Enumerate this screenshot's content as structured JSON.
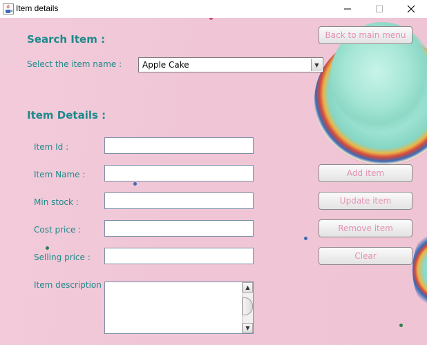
{
  "window": {
    "title": "Item details",
    "minimize_glyph": "—",
    "maximize_glyph": "☐",
    "close_glyph": "✕"
  },
  "search": {
    "heading": "Search Item :",
    "select_label": "Select the item name :",
    "selected_item": "Apple Cake"
  },
  "details": {
    "heading": "Item Details :",
    "item_id_label": "Item Id :",
    "item_name_label": "Item Name :",
    "min_stock_label": "Min stock :",
    "cost_price_label": "Cost price :",
    "selling_price_label": "Selling price :",
    "description_label": "Item description :",
    "item_id_value": "",
    "item_name_value": "",
    "min_stock_value": "",
    "cost_price_value": "",
    "selling_price_value": "",
    "description_value": ""
  },
  "buttons": {
    "back": "Back to main menu",
    "add": "Add item",
    "update": "Update item",
    "remove": "Remove item",
    "clear": "Clear"
  },
  "icons": {
    "app": "java-coffee-cup-icon",
    "combo_arrow": "▼",
    "scroll_up": "▲",
    "scroll_down": "▼"
  },
  "colors": {
    "label_teal": "#1e8a8a",
    "button_text_pink": "#e58fb2",
    "background_pink": "#f0c6d6"
  }
}
